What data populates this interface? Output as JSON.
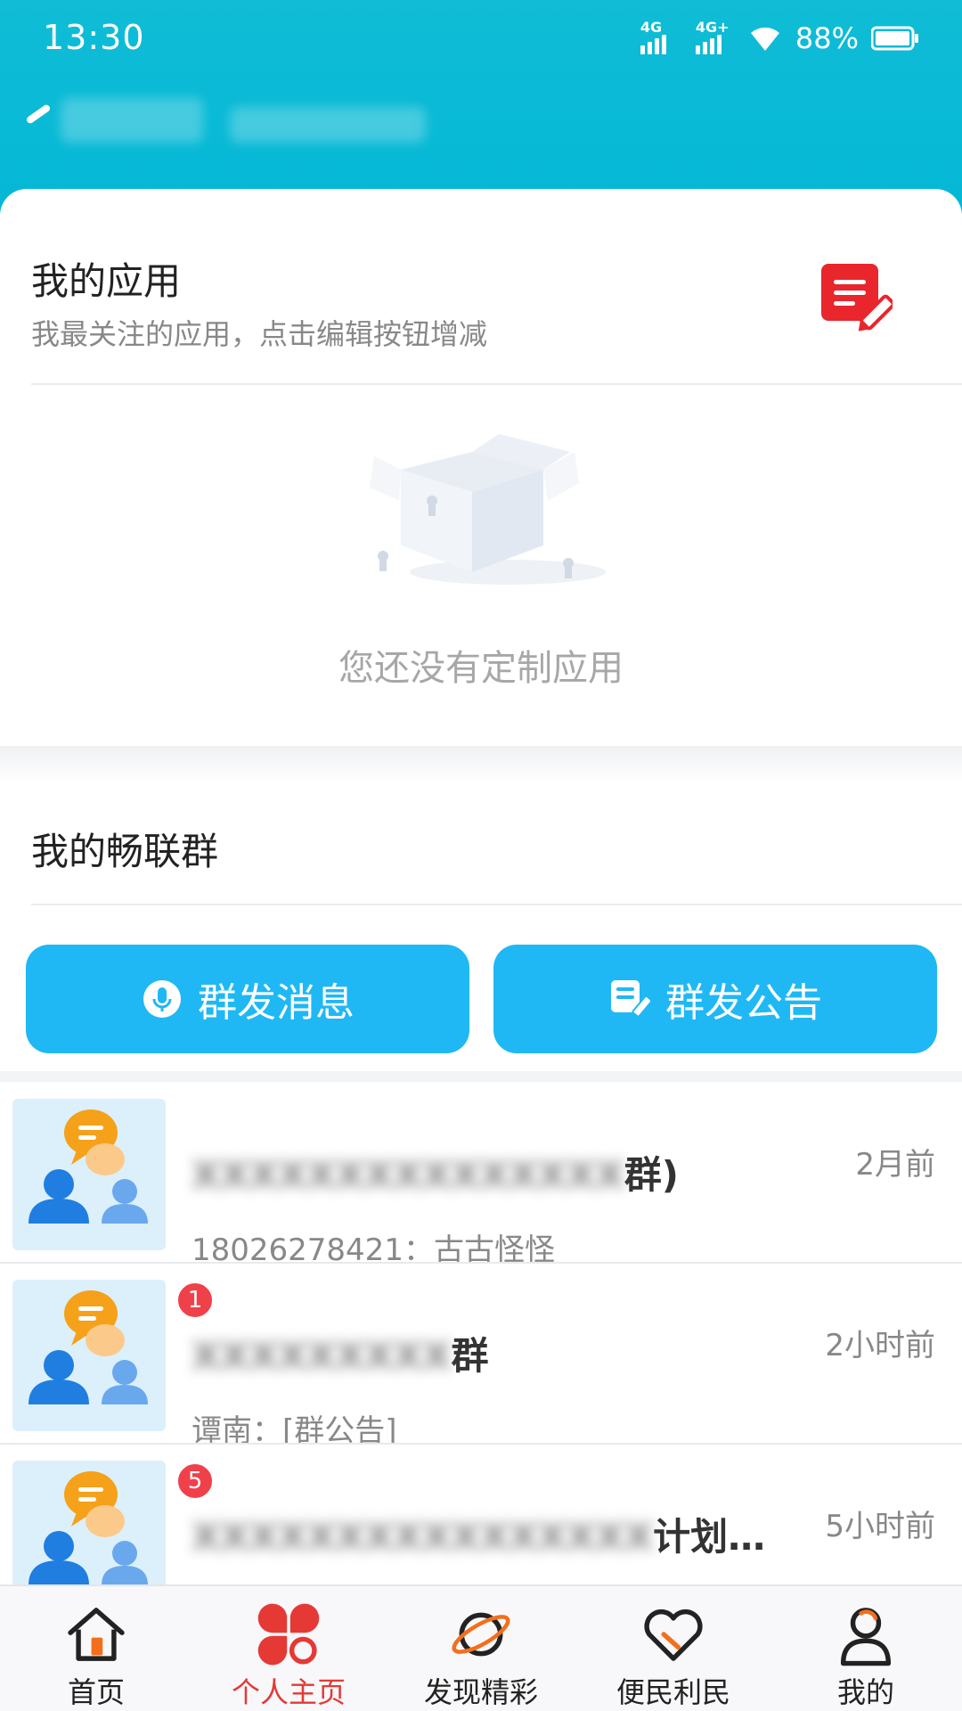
{
  "status_bar": {
    "time": "13:30",
    "network1": "4G",
    "network2": "4G+",
    "battery": "88%"
  },
  "apps_section": {
    "title": "我的应用",
    "subtitle": "我最关注的应用，点击编辑按钮增减",
    "empty_text": "您还没有定制应用",
    "edit_icon": "edit-note-icon"
  },
  "groups_section": {
    "title": "我的畅联群",
    "broadcast_message_label": "群发消息",
    "broadcast_notice_label": "群发公告"
  },
  "groups": [
    {
      "name_suffix": "群)",
      "time": "2月前",
      "message": "18026278421：古古怪怪",
      "badge": ""
    },
    {
      "name_suffix": "群",
      "time": "2小时前",
      "message": "谭南：[群公告]",
      "badge": "1"
    },
    {
      "name_suffix": "计划…",
      "time": "5小时前",
      "message": "",
      "badge": "5"
    }
  ],
  "tabs": [
    {
      "label": "首页",
      "icon": "home-icon"
    },
    {
      "label": "个人主页",
      "icon": "clover-icon",
      "active": true
    },
    {
      "label": "发现精彩",
      "icon": "planet-icon"
    },
    {
      "label": "便民利民",
      "icon": "heart-icon"
    },
    {
      "label": "我的",
      "icon": "user-icon"
    }
  ],
  "colors": {
    "header": "#04b8d6",
    "button": "#1fb8f5",
    "badge": "#f0404a",
    "active_tab": "#e53935"
  }
}
